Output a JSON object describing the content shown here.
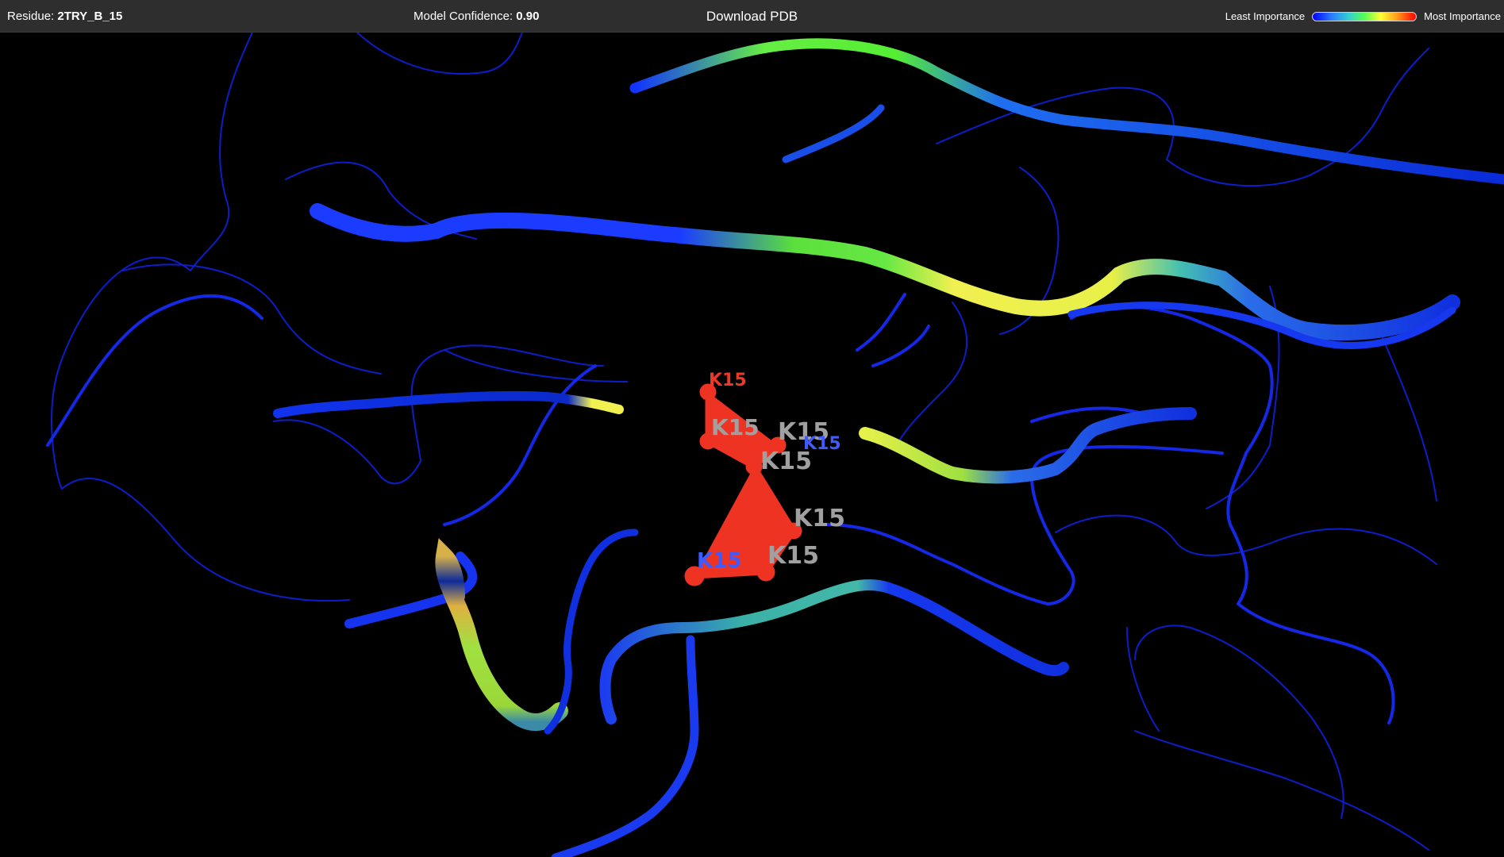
{
  "header": {
    "residue_label": "Residue:",
    "residue_value": "2TRY_B_15",
    "confidence_label": "Model Confidence:",
    "confidence_value": "0.90",
    "download_label": "Download PDB",
    "legend_min_label": "Least Importance",
    "legend_max_label": "Most Importance"
  },
  "colors": {
    "background": "#000000",
    "toolbar": "#2e2e2e",
    "low_importance": "#0000ff",
    "high_importance": "#ff0000",
    "selected_residue": "#ee3322"
  },
  "viewer": {
    "residue_labels": [
      {
        "text": "K15",
        "color": "#e83a2a"
      },
      {
        "text": "K15",
        "color": "#a0a0a0"
      },
      {
        "text": "K15",
        "color": "#a0a0a0"
      },
      {
        "text": "K15",
        "color": "#3f5bff"
      },
      {
        "text": "K15",
        "color": "#a0a0a0"
      },
      {
        "text": "K15",
        "color": "#a0a0a0"
      },
      {
        "text": "K15",
        "color": "#a0a0a0"
      },
      {
        "text": "K15",
        "color": "#3f5bff"
      }
    ]
  }
}
